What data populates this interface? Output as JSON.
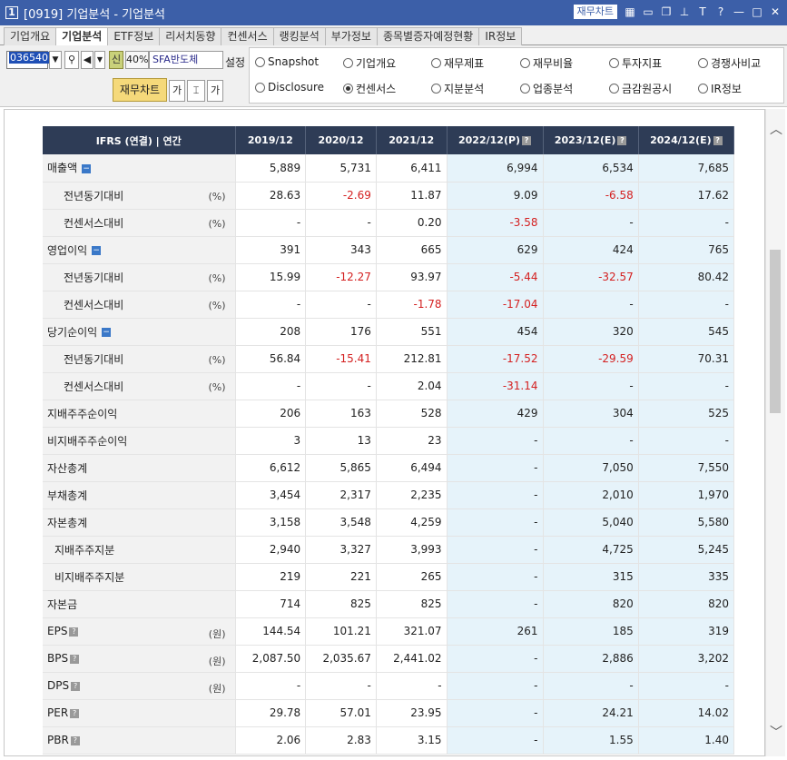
{
  "window": {
    "number": "1",
    "title": "[0919] 기업분석 - 기업분석",
    "fin_chart_label": "재무차트"
  },
  "tabs": [
    {
      "label": "기업개요",
      "active": false
    },
    {
      "label": "기업분석",
      "active": true
    },
    {
      "label": "ETF정보",
      "active": false
    },
    {
      "label": "리서치동향",
      "active": false
    },
    {
      "label": "컨센서스",
      "active": false
    },
    {
      "label": "랭킹분석",
      "active": false
    },
    {
      "label": "부가정보",
      "active": false
    },
    {
      "label": "종목별증자예정현황",
      "active": false
    },
    {
      "label": "IR정보",
      "active": false
    }
  ],
  "toolbar": {
    "code": "036540",
    "new_label": "신",
    "pct": "40%",
    "stock_name": "SFA반도체",
    "settings_label": "설정",
    "fin_chart_button": "재무차트",
    "font_label": "가"
  },
  "radios": [
    {
      "label": "Snapshot",
      "checked": false
    },
    {
      "label": "기업개요",
      "checked": false
    },
    {
      "label": "재무제표",
      "checked": false
    },
    {
      "label": "재무비율",
      "checked": false
    },
    {
      "label": "투자지표",
      "checked": false
    },
    {
      "label": "경쟁사비교",
      "checked": false
    },
    {
      "label": "Disclosure",
      "checked": false
    },
    {
      "label": "컨센서스",
      "checked": true
    },
    {
      "label": "지분분석",
      "checked": false
    },
    {
      "label": "업종분석",
      "checked": false
    },
    {
      "label": "금감원공시",
      "checked": false
    },
    {
      "label": "IR정보",
      "checked": false
    }
  ],
  "table": {
    "header": "IFRS (연결) | 연간",
    "columns": [
      {
        "label": "2019/12",
        "est": false,
        "help": false
      },
      {
        "label": "2020/12",
        "est": false,
        "help": false
      },
      {
        "label": "2021/12",
        "est": false,
        "help": false
      },
      {
        "label": "2022/12(P)",
        "est": true,
        "help": true
      },
      {
        "label": "2023/12(E)",
        "est": true,
        "help": true
      },
      {
        "label": "2024/12(E)",
        "est": true,
        "help": true
      }
    ],
    "rows": [
      {
        "label": "매출액",
        "indent": 0,
        "unit": "",
        "expand": true,
        "help": false,
        "values": [
          "5,889",
          "5,731",
          "6,411",
          "6,994",
          "6,534",
          "7,685"
        ]
      },
      {
        "label": "전년동기대비",
        "indent": 2,
        "unit": "(%)",
        "expand": false,
        "help": false,
        "values": [
          "28.63",
          "-2.69",
          "11.87",
          "9.09",
          "-6.58",
          "17.62"
        ]
      },
      {
        "label": "컨센서스대비",
        "indent": 2,
        "unit": "(%)",
        "expand": false,
        "help": false,
        "values": [
          "-",
          "-",
          "0.20",
          "-3.58",
          "-",
          "-"
        ]
      },
      {
        "label": "영업이익",
        "indent": 0,
        "unit": "",
        "expand": true,
        "help": false,
        "values": [
          "391",
          "343",
          "665",
          "629",
          "424",
          "765"
        ]
      },
      {
        "label": "전년동기대비",
        "indent": 2,
        "unit": "(%)",
        "expand": false,
        "help": false,
        "values": [
          "15.99",
          "-12.27",
          "93.97",
          "-5.44",
          "-32.57",
          "80.42"
        ]
      },
      {
        "label": "컨센서스대비",
        "indent": 2,
        "unit": "(%)",
        "expand": false,
        "help": false,
        "values": [
          "-",
          "-",
          "-1.78",
          "-17.04",
          "-",
          "-"
        ]
      },
      {
        "label": "당기순이익",
        "indent": 0,
        "unit": "",
        "expand": true,
        "help": false,
        "values": [
          "208",
          "176",
          "551",
          "454",
          "320",
          "545"
        ]
      },
      {
        "label": "전년동기대비",
        "indent": 2,
        "unit": "(%)",
        "expand": false,
        "help": false,
        "values": [
          "56.84",
          "-15.41",
          "212.81",
          "-17.52",
          "-29.59",
          "70.31"
        ]
      },
      {
        "label": "컨센서스대비",
        "indent": 2,
        "unit": "(%)",
        "expand": false,
        "help": false,
        "values": [
          "-",
          "-",
          "2.04",
          "-31.14",
          "-",
          "-"
        ]
      },
      {
        "label": "지배주주순이익",
        "indent": 0,
        "unit": "",
        "expand": false,
        "help": false,
        "values": [
          "206",
          "163",
          "528",
          "429",
          "304",
          "525"
        ]
      },
      {
        "label": "비지배주주순이익",
        "indent": 0,
        "unit": "",
        "expand": false,
        "help": false,
        "values": [
          "3",
          "13",
          "23",
          "-",
          "-",
          "-"
        ]
      },
      {
        "label": "자산총계",
        "indent": 0,
        "unit": "",
        "expand": false,
        "help": false,
        "values": [
          "6,612",
          "5,865",
          "6,494",
          "-",
          "7,050",
          "7,550"
        ]
      },
      {
        "label": "부채총계",
        "indent": 0,
        "unit": "",
        "expand": false,
        "help": false,
        "values": [
          "3,454",
          "2,317",
          "2,235",
          "-",
          "2,010",
          "1,970"
        ]
      },
      {
        "label": "자본총계",
        "indent": 0,
        "unit": "",
        "expand": false,
        "help": false,
        "values": [
          "3,158",
          "3,548",
          "4,259",
          "-",
          "5,040",
          "5,580"
        ]
      },
      {
        "label": "지배주주지분",
        "indent": 1,
        "unit": "",
        "expand": false,
        "help": false,
        "values": [
          "2,940",
          "3,327",
          "3,993",
          "-",
          "4,725",
          "5,245"
        ]
      },
      {
        "label": "비지배주주지분",
        "indent": 1,
        "unit": "",
        "expand": false,
        "help": false,
        "values": [
          "219",
          "221",
          "265",
          "-",
          "315",
          "335"
        ]
      },
      {
        "label": "자본금",
        "indent": 0,
        "unit": "",
        "expand": false,
        "help": false,
        "values": [
          "714",
          "825",
          "825",
          "-",
          "820",
          "820"
        ]
      },
      {
        "label": "EPS",
        "indent": 0,
        "unit": "(원)",
        "expand": false,
        "help": true,
        "values": [
          "144.54",
          "101.21",
          "321.07",
          "261",
          "185",
          "319"
        ]
      },
      {
        "label": "BPS",
        "indent": 0,
        "unit": "(원)",
        "expand": false,
        "help": true,
        "values": [
          "2,087.50",
          "2,035.67",
          "2,441.02",
          "-",
          "2,886",
          "3,202"
        ]
      },
      {
        "label": "DPS",
        "indent": 0,
        "unit": "(원)",
        "expand": false,
        "help": true,
        "values": [
          "-",
          "-",
          "-",
          "-",
          "-",
          "-"
        ]
      },
      {
        "label": "PER",
        "indent": 0,
        "unit": "",
        "expand": false,
        "help": true,
        "values": [
          "29.78",
          "57.01",
          "23.95",
          "-",
          "24.21",
          "14.02"
        ]
      },
      {
        "label": "PBR",
        "indent": 0,
        "unit": "",
        "expand": false,
        "help": true,
        "values": [
          "2.06",
          "2.83",
          "3.15",
          "-",
          "1.55",
          "1.40"
        ]
      }
    ]
  }
}
